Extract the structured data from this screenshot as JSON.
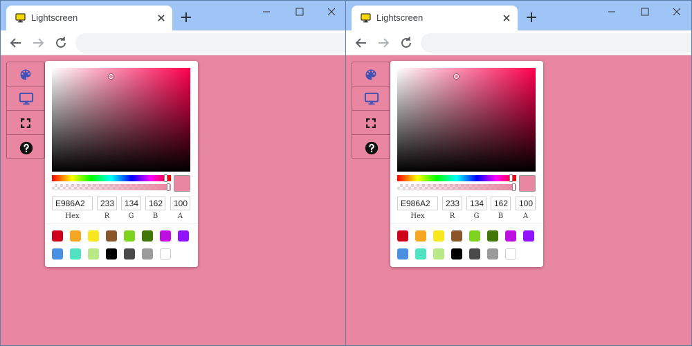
{
  "windows": [
    {
      "id": "left"
    },
    {
      "id": "right"
    }
  ],
  "browser": {
    "tab_title": "Lightscreen",
    "favicon": "monitor-icon",
    "address": ""
  },
  "picker": {
    "hex": "E986A2",
    "r": "233",
    "g": "134",
    "b": "162",
    "a": "100",
    "labels": {
      "hex": "Hex",
      "r": "R",
      "g": "G",
      "b": "B",
      "a": "A"
    },
    "current_color": "#e986a2",
    "hue_color": "#ff004e",
    "saturation": 0.42,
    "value": 0.91,
    "hue_degrees": 343,
    "alpha": 1.0
  },
  "sidebar": {
    "buttons": [
      {
        "name": "palette",
        "icon": "palette-icon"
      },
      {
        "name": "monitor",
        "icon": "monitor-icon"
      },
      {
        "name": "fullscreen",
        "icon": "fullscreen-icon"
      },
      {
        "name": "help",
        "icon": "help-icon"
      }
    ]
  },
  "swatches": [
    "#d0021b",
    "#f5a623",
    "#f8e71c",
    "#8b572a",
    "#7ed321",
    "#417505",
    "#bd10e0",
    "#9013fe",
    "#4a90e2",
    "#50e3c2",
    "#b8e986",
    "#000000",
    "#4a4a4a",
    "#9b9b9b",
    "#ffffff"
  ],
  "colors": {
    "page_background": "#e986a2",
    "titlebar": "#9ec5f5",
    "sidebar_icon": "#3f51b5"
  }
}
